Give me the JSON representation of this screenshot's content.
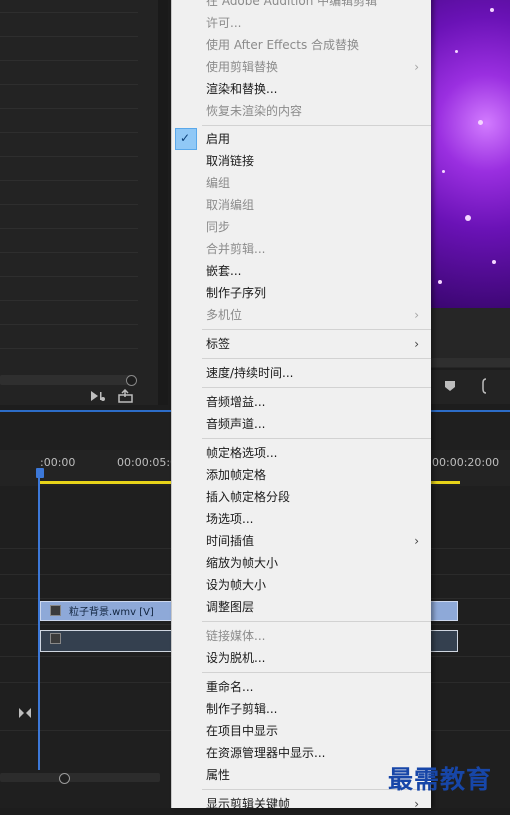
{
  "context_menu": {
    "items": [
      {
        "label": "在 Adobe Audition 中编辑剪辑",
        "enabled": false
      },
      {
        "label": "许可...",
        "enabled": false
      },
      {
        "label": "使用 After Effects 合成替换",
        "enabled": false
      },
      {
        "label": "使用剪辑替换",
        "enabled": false,
        "submenu": true
      },
      {
        "label": "渲染和替换...",
        "enabled": true
      },
      {
        "label": "恢复未渲染的内容",
        "enabled": false
      },
      {
        "label": "启用",
        "enabled": true,
        "checked": true
      },
      {
        "label": "取消链接",
        "enabled": true
      },
      {
        "label": "编组",
        "enabled": false
      },
      {
        "label": "取消编组",
        "enabled": false
      },
      {
        "label": "同步",
        "enabled": false
      },
      {
        "label": "合并剪辑...",
        "enabled": false
      },
      {
        "label": "嵌套...",
        "enabled": true
      },
      {
        "label": "制作子序列",
        "enabled": true
      },
      {
        "label": "多机位",
        "enabled": false,
        "submenu": true
      },
      {
        "label": "标签",
        "enabled": true,
        "submenu": true
      },
      {
        "label": "速度/持续时间...",
        "enabled": true
      },
      {
        "label": "音频增益...",
        "enabled": true
      },
      {
        "label": "音频声道...",
        "enabled": true
      },
      {
        "label": "帧定格选项...",
        "enabled": true
      },
      {
        "label": "添加帧定格",
        "enabled": true
      },
      {
        "label": "插入帧定格分段",
        "enabled": true
      },
      {
        "label": "场选项...",
        "enabled": true
      },
      {
        "label": "时间插值",
        "enabled": true,
        "submenu": true
      },
      {
        "label": "缩放为帧大小",
        "enabled": true
      },
      {
        "label": "设为帧大小",
        "enabled": true
      },
      {
        "label": "调整图层",
        "enabled": true
      },
      {
        "label": "链接媒体...",
        "enabled": false
      },
      {
        "label": "设为脱机...",
        "enabled": true
      },
      {
        "label": "重命名...",
        "enabled": true
      },
      {
        "label": "制作子剪辑...",
        "enabled": true
      },
      {
        "label": "在项目中显示",
        "enabled": true
      },
      {
        "label": "在资源管理器中显示...",
        "enabled": true
      },
      {
        "label": "属性",
        "enabled": true
      },
      {
        "label": "显示剪辑关键帧",
        "enabled": true,
        "submenu": true
      }
    ],
    "submenu_arrow": "›",
    "check_mark": "✓"
  },
  "timeline": {
    "timecodes": [
      ":00:00",
      "00:00:05:00",
      "00:00:20:00"
    ],
    "video_clip_label": "粒子背景.wmv [V]",
    "fx_badge": "fx"
  },
  "watermark": "最需教育",
  "colors": {
    "menu_bg": "#f0f0f0",
    "check_highlight": "#90c8f6",
    "playhead": "#3c78d8",
    "work_area": "#e7d319",
    "video_clip": "#8ea9d8",
    "audio_clip": "#34404f",
    "watermark": "#1746a8"
  }
}
